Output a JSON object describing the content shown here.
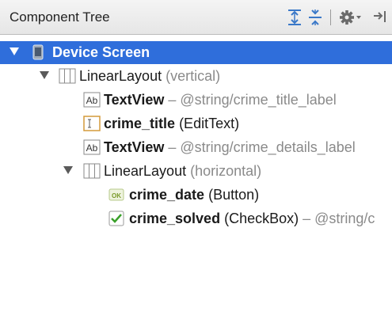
{
  "panel": {
    "title": "Component Tree",
    "toolbar_icons": [
      "expand-all-icon",
      "collapse-all-icon",
      "gear-icon",
      "hide-panel-icon"
    ]
  },
  "tree": {
    "device_screen": {
      "label": "Device Screen",
      "icon": "phone-icon"
    },
    "linear_vertical": {
      "name": "LinearLayout",
      "detail": "(vertical)",
      "icon": "linear-layout-icon"
    },
    "textview_title": {
      "name": "TextView",
      "sep": " – ",
      "detail": "@string/crime_title_label",
      "icon": "textview-icon",
      "icon_text": "Ab"
    },
    "crime_title": {
      "name": "crime_title",
      "detail": "(EditText)",
      "icon": "edittext-icon"
    },
    "textview_details": {
      "name": "TextView",
      "sep": " – ",
      "detail": "@string/crime_details_label",
      "icon": "textview-icon",
      "icon_text": "Ab"
    },
    "linear_horizontal": {
      "name": "LinearLayout",
      "detail": "(horizontal)",
      "icon": "linear-layout-icon"
    },
    "crime_date": {
      "name": "crime_date",
      "detail": "(Button)",
      "icon": "button-icon",
      "icon_text": "OK"
    },
    "crime_solved": {
      "name": "crime_solved",
      "detail": "(CheckBox)",
      "sep": " – ",
      "extra": "@string/c",
      "icon": "checkbox-icon"
    }
  },
  "colors": {
    "selection": "#2f6edb",
    "header_bg": "#e8e8e8",
    "muted_text": "#8a8a8a"
  }
}
